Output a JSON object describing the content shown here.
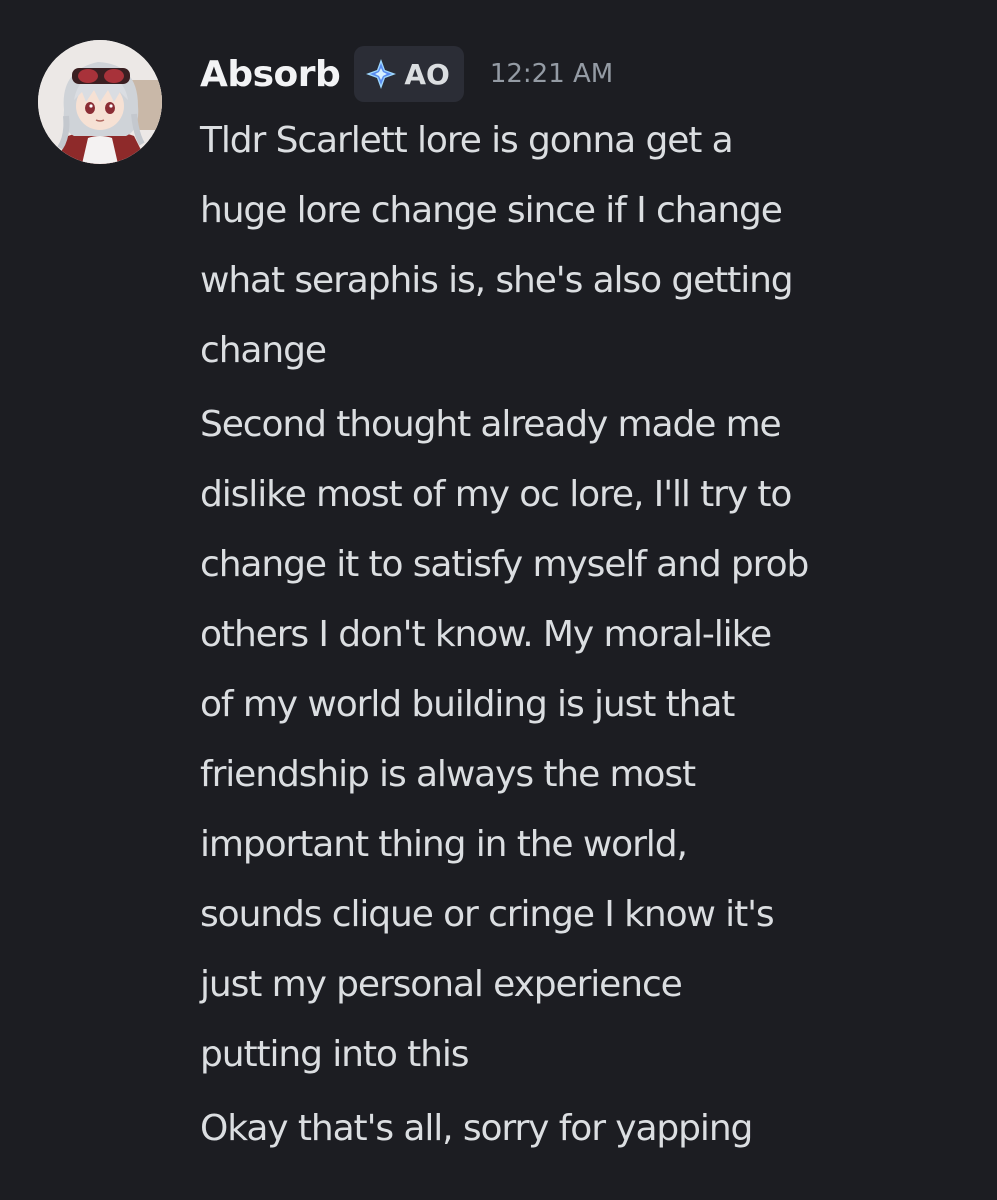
{
  "author": {
    "username": "Absorb",
    "tag_label": "AO",
    "tag_icon": "sparkle-diamond-icon",
    "timestamp": "12:21 AM",
    "avatar": "anime-character-avatar"
  },
  "messages": [
    "Tldr Scarlett lore is gonna get a\nhuge lore change since if I change\nwhat seraphis is, she's also getting\nchange",
    "Second thought already made me\ndislike most of my oc lore, I'll try to\nchange it to satisfy myself and prob\nothers I don't know. My moral-like\nof my world building is just that\nfriendship is always the most\nimportant thing in the world,\nsounds clique or cringe I know it's\njust my personal experience\nputting into this",
    "Okay that's all, sorry for yapping"
  ],
  "colors": {
    "background": "#1c1d22",
    "text": "#dbdee1",
    "username": "#f2f3f5",
    "timestamp": "#949ba4",
    "tag_background": "#2b2d36"
  }
}
